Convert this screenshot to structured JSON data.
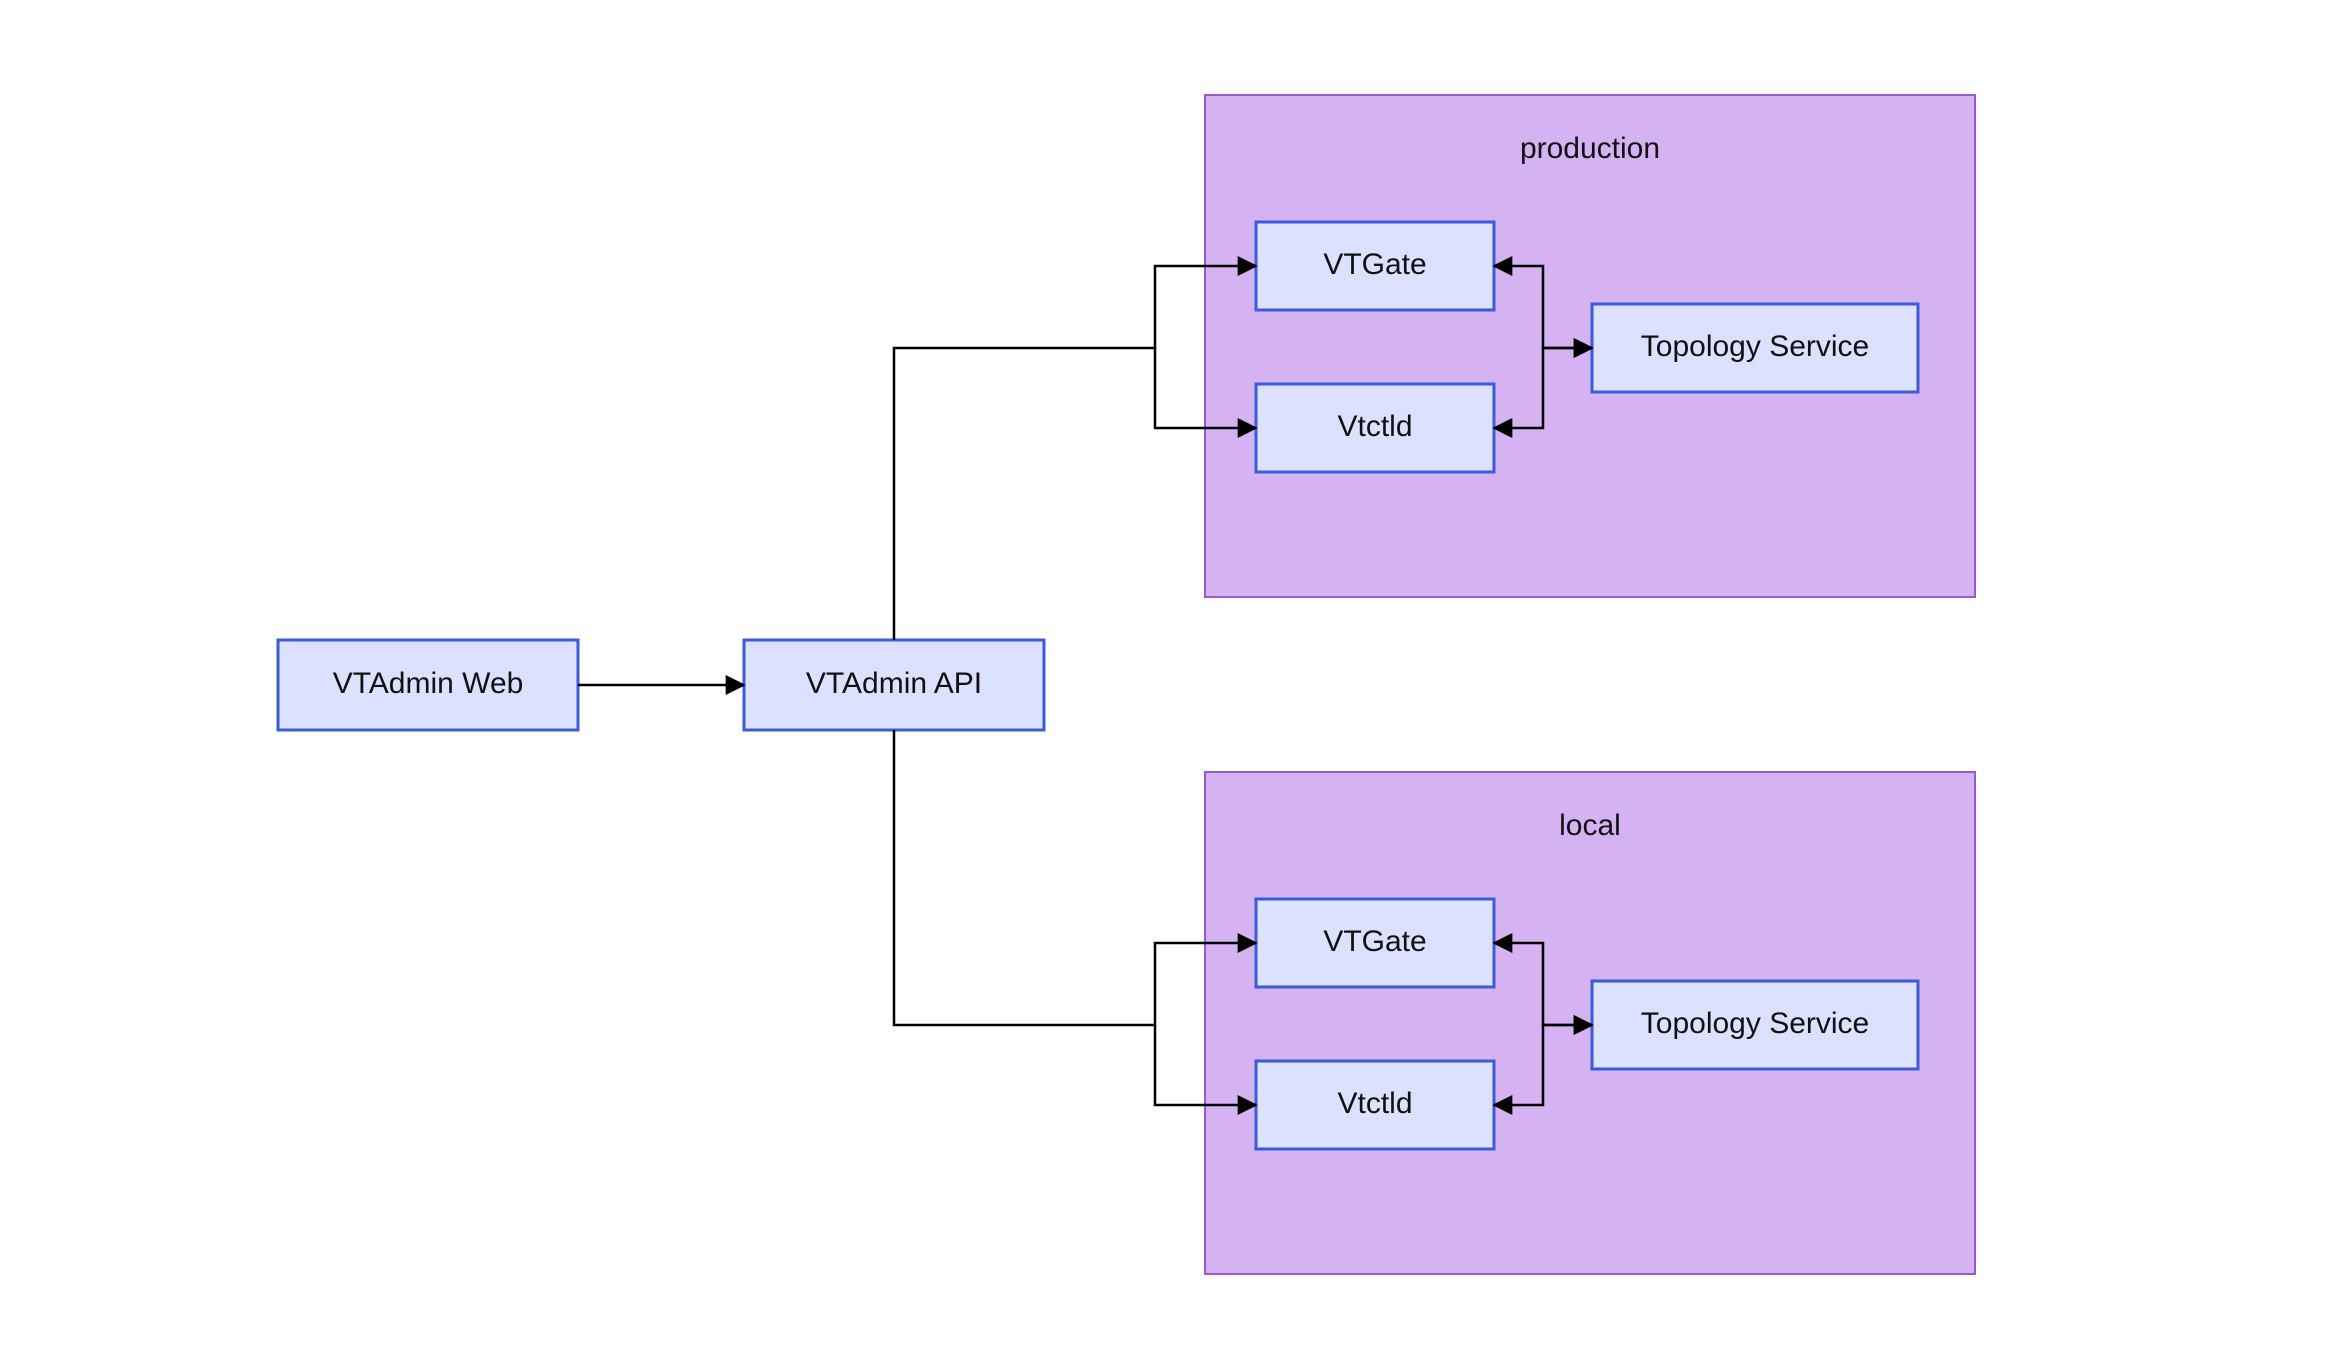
{
  "nodes": {
    "vtadmin_web": "VTAdmin Web",
    "vtadmin_api": "VTAdmin API"
  },
  "clusters": {
    "production": {
      "title": "production",
      "vtgate": "VTGate",
      "vtctld": "Vtctld",
      "topo": "Topology Service"
    },
    "local": {
      "title": "local",
      "vtgate": "VTGate",
      "vtctld": "Vtctld",
      "topo": "Topology Service"
    }
  }
}
